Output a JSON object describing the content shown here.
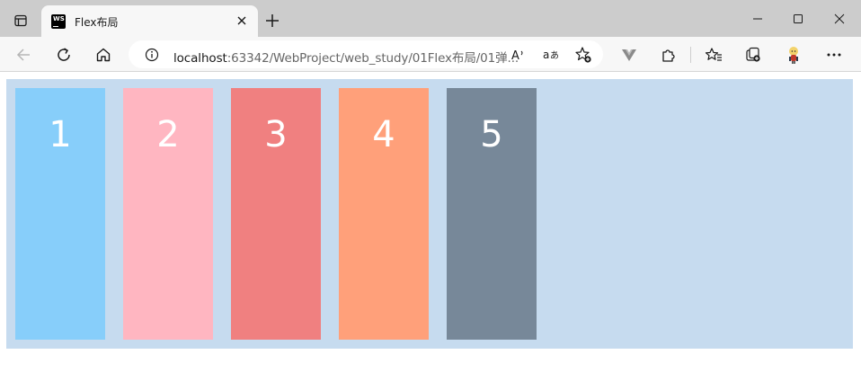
{
  "tab": {
    "favicon_text": "WS",
    "title": "Flex布局"
  },
  "address": {
    "url_host": "localhost",
    "url_rest": ":63342/WebProject/web_study/01Flex布局/01弹..."
  },
  "icons": {
    "tab_actions": "tab-actions-icon",
    "close": "close-icon",
    "new_tab": "plus-icon",
    "minimize": "minimize-icon",
    "maximize": "maximize-icon",
    "window_close": "close-icon",
    "back": "back-arrow-icon",
    "refresh": "refresh-icon",
    "home": "home-icon",
    "info": "info-icon",
    "read_aloud": "read-aloud-icon",
    "translate": "translate-icon",
    "add_favorite": "star-plus-icon",
    "vue_devtools": "vue-icon",
    "extensions": "puzzle-icon",
    "favorites": "favorites-icon",
    "collections": "collections-icon",
    "profile": "avatar-icon",
    "more": "more-icon"
  },
  "colors": {
    "container": "#c6dbef",
    "item_1": "#87cefa",
    "item_2": "#ffb6c1",
    "item_3": "#f08080",
    "item_4": "#ffa07a",
    "item_5": "#778899"
  },
  "flex_items": [
    {
      "label": "1",
      "color": "#87cefa"
    },
    {
      "label": "2",
      "color": "#ffb6c1"
    },
    {
      "label": "3",
      "color": "#f08080"
    },
    {
      "label": "4",
      "color": "#ffa07a"
    },
    {
      "label": "5",
      "color": "#778899"
    }
  ]
}
